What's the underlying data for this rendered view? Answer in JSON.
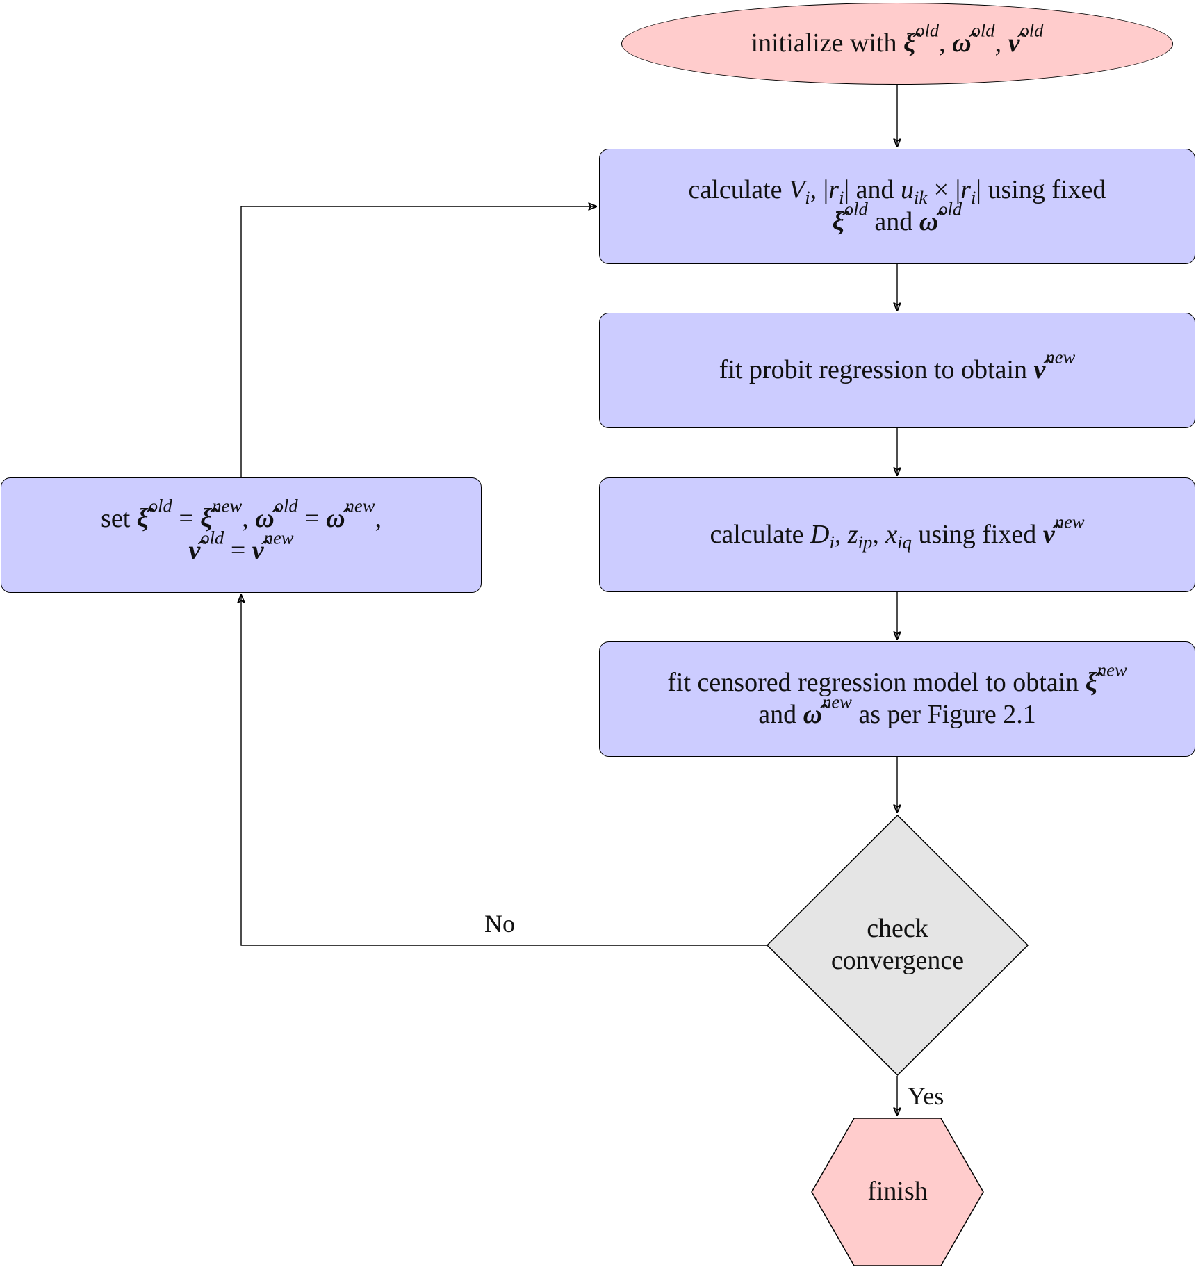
{
  "diagram": {
    "type": "flowchart",
    "colors": {
      "terminal_fill": "#ffcccc",
      "process_fill": "#ccccff",
      "decision_fill": "#e5e5e5",
      "stroke": "#000000"
    },
    "nodes": {
      "start": {
        "shape": "ellipse",
        "text": "initialize with ξ̂ᵒˡᵈ, ω̂ᵒˡᵈ, ν̂ᵒˡᵈ",
        "parts": {
          "prefix": "initialize with",
          "xi": "ξ̂",
          "omega": "ω̂",
          "nu": "ν̂",
          "old": "old",
          "sep": ","
        }
      },
      "step1": {
        "shape": "rounded-rectangle",
        "text": "calculate V_i, |r_i| and u_ik × |r_i| using fixed ξ̂ᵒˡᵈ and ω̂ᵒˡᵈ",
        "parts": {
          "calculate": "calculate",
          "V": "V",
          "i": "i",
          "r": "r",
          "and": "and",
          "u": "u",
          "ik": "ik",
          "times": "×",
          "using_fixed": "using fixed",
          "xi": "ξ̂",
          "omega": "ω̂",
          "old": "old"
        }
      },
      "step2": {
        "shape": "rounded-rectangle",
        "text": "fit probit regression to obtain ν̂ⁿᵉʷ",
        "parts": {
          "prefix": "fit probit regression to obtain",
          "nu": "ν̂",
          "new": "new"
        }
      },
      "step3": {
        "shape": "rounded-rectangle",
        "text": "calculate D_i, z_ip, x_iq using fixed ν̂ⁿᵉʷ",
        "parts": {
          "calculate": "calculate",
          "D": "D",
          "i": "i",
          "z": "z",
          "ip": "ip",
          "x": "x",
          "iq": "iq",
          "using_fixed": "using fixed",
          "nu": "ν̂",
          "new": "new"
        }
      },
      "step4": {
        "shape": "rounded-rectangle",
        "text": "fit censored regression model to obtain ξ̂ⁿᵉʷ and ω̂ⁿᵉʷ as per Figure 2.1",
        "parts": {
          "prefix": "fit censored regression model to obtain",
          "xi": "ξ̂",
          "new": "new",
          "and": "and",
          "omega": "ω̂",
          "suffix": "as per Figure 2.1"
        }
      },
      "decision": {
        "shape": "diamond",
        "text": "check convergence",
        "line1": "check",
        "line2": "convergence"
      },
      "update": {
        "shape": "rounded-rectangle",
        "text": "set ξ̂ᵒˡᵈ = ξ̂ⁿᵉʷ, ω̂ᵒˡᵈ = ω̂ⁿᵉʷ, ν̂ᵒˡᵈ = ν̂ⁿᵉʷ",
        "parts": {
          "set": "set",
          "xi": "ξ̂",
          "omega": "ω̂",
          "nu": "ν̂",
          "old": "old",
          "new": "new",
          "eq": "=",
          "comma": ","
        }
      },
      "finish": {
        "shape": "hexagon",
        "text": "finish"
      }
    },
    "edges": [
      {
        "from": "start",
        "to": "step1",
        "label": ""
      },
      {
        "from": "step1",
        "to": "step2",
        "label": ""
      },
      {
        "from": "step2",
        "to": "step3",
        "label": ""
      },
      {
        "from": "step3",
        "to": "step4",
        "label": ""
      },
      {
        "from": "step4",
        "to": "decision",
        "label": ""
      },
      {
        "from": "decision",
        "to": "update",
        "label": "No"
      },
      {
        "from": "update",
        "to": "step1",
        "label": ""
      },
      {
        "from": "decision",
        "to": "finish",
        "label": "Yes"
      }
    ],
    "edge_labels": {
      "no": "No",
      "yes": "Yes"
    }
  }
}
